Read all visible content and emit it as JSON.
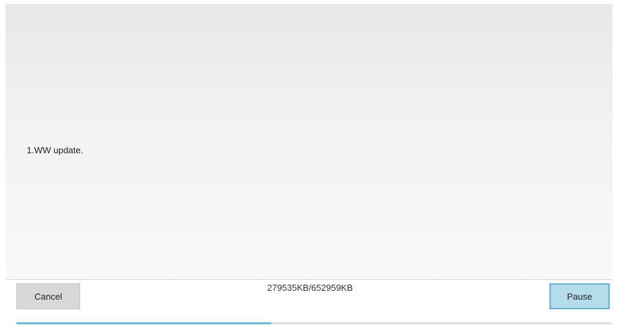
{
  "message": "1.WW update.",
  "progress": {
    "text": "279535KB/652959KB",
    "downloaded_kb": 279535,
    "total_kb": 652959,
    "fraction": 0.428,
    "color": "#6bbcd8"
  },
  "buttons": {
    "cancel_label": "Cancel",
    "pause_label": "Pause"
  },
  "colors": {
    "pause_bg": "#b4dcea",
    "pause_border": "#67b2cc",
    "cancel_bg": "#d8d8d8"
  }
}
